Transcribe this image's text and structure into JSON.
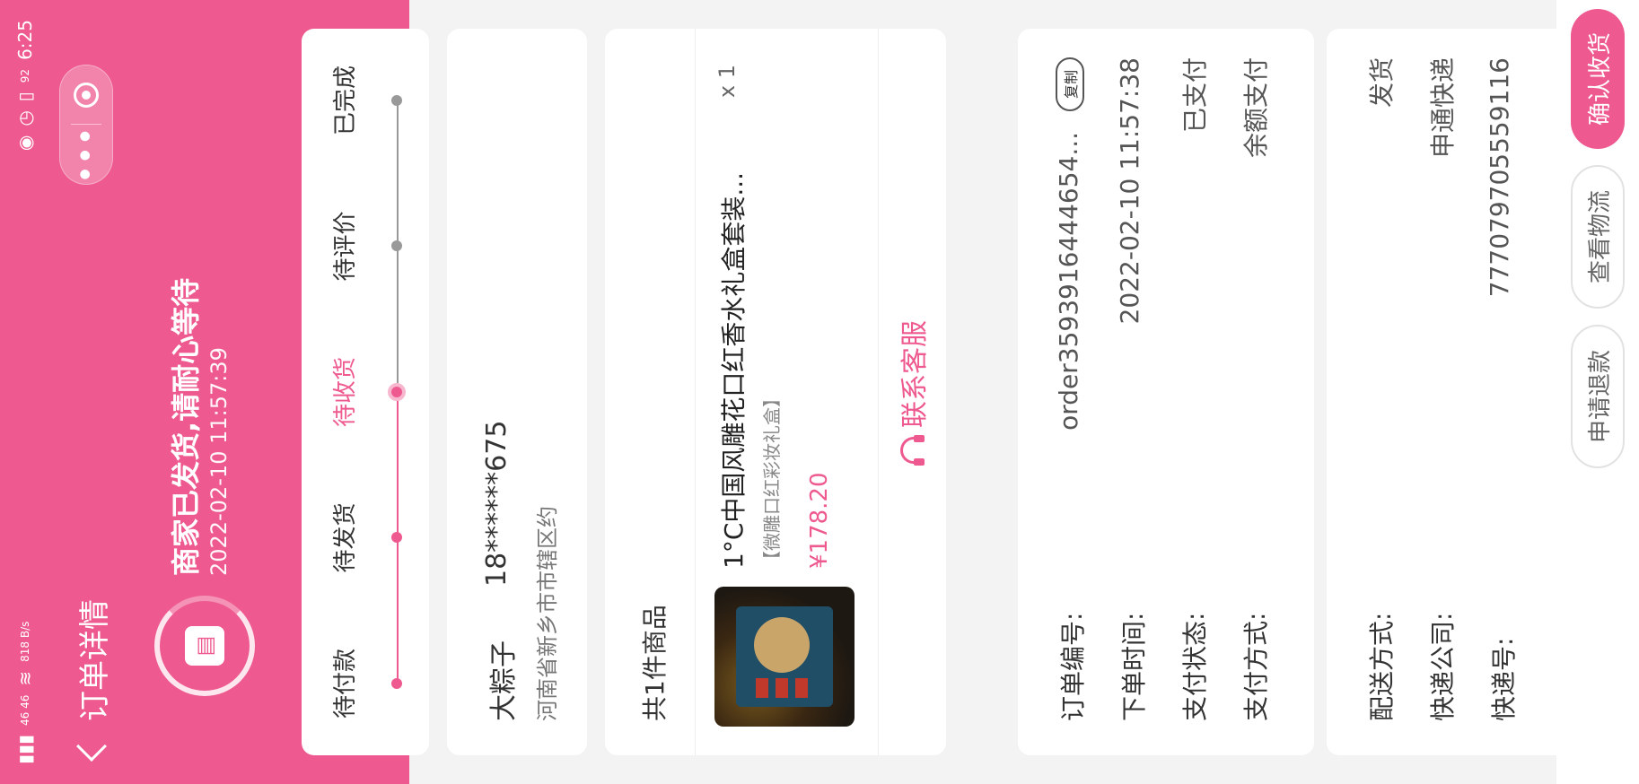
{
  "status_bar": {
    "left_text": "46 46",
    "speed": "818 B/s",
    "battery": "92",
    "time": "6:25"
  },
  "nav": {
    "title": "订单详情",
    "back_icon": "chevron-left-icon",
    "more_icon": "more-dots-icon",
    "close_icon": "target-close-icon"
  },
  "order_status": {
    "icon": "receipt-icon",
    "text": "商家已发货,请耐心等待",
    "time": "2022-02-10 11:57:39"
  },
  "progress": {
    "steps": [
      {
        "label": "待付款"
      },
      {
        "label": "待发货"
      },
      {
        "label": "待收货"
      },
      {
        "label": "待评价"
      },
      {
        "label": "已完成"
      }
    ],
    "active_index": 2
  },
  "address": {
    "name": "大粽子",
    "phone": "18******675",
    "line": "河南省新乡市市辖区约"
  },
  "goods": {
    "count_label": "共1件商品",
    "items": [
      {
        "name": "1°C中国风雕花口红香水礼盒套装...",
        "spec": "【微雕口红彩妆礼盒】",
        "price": "¥178.20",
        "qty": "x 1"
      }
    ],
    "service_label": "联系客服",
    "service_icon": "headset-icon"
  },
  "order_info": {
    "rows": [
      {
        "label": "订单编号:",
        "value": "order359391644465​4..."
      },
      {
        "label": "下单时间:",
        "value": "2022-02-10 11:57:38"
      },
      {
        "label": "支付状态:",
        "value": "已支付"
      },
      {
        "label": "支付方式:",
        "value": "余额支付"
      }
    ],
    "copy_label": "复制"
  },
  "shipping": {
    "rows": [
      {
        "label": "配送方式:",
        "value": "发货"
      },
      {
        "label": "快递公司:",
        "value": "申通快递"
      },
      {
        "label": "快递号:",
        "value": "777079705559116"
      }
    ]
  },
  "actions": {
    "refund": "申请退款",
    "logistics": "查看物流",
    "confirm": "确认收货"
  },
  "colors": {
    "brand": "#ee5a8f"
  }
}
